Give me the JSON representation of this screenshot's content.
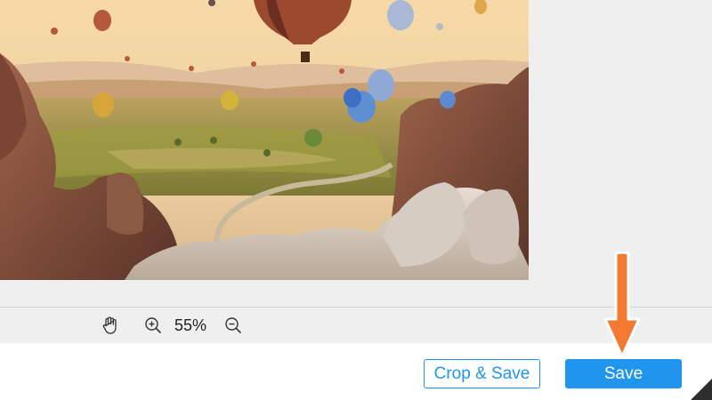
{
  "toolbar": {
    "zoom_level": "55%",
    "tools": [
      {
        "name": "pan",
        "icon": "hand-icon"
      },
      {
        "name": "zoom-in",
        "icon": "zoom-in-icon"
      },
      {
        "name": "zoom-out",
        "icon": "zoom-out-icon"
      }
    ]
  },
  "actions": {
    "crop_save_label": "Crop & Save",
    "save_label": "Save"
  },
  "colors": {
    "accent": "#1f95ee",
    "panel_bg": "#efeff0",
    "arrow": "#f47a32"
  }
}
